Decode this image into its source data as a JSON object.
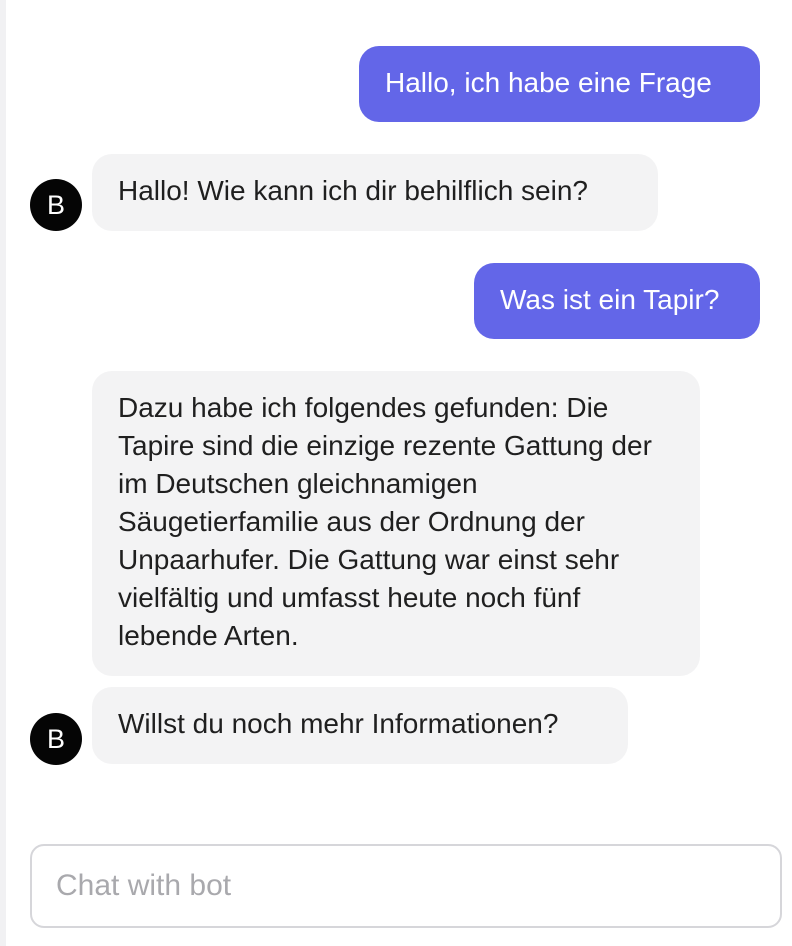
{
  "chat": {
    "header_fragment": "· · · · · · ·",
    "messages": [
      {
        "sender": "user",
        "text": "Hallo, ich habe eine Frage"
      },
      {
        "sender": "bot",
        "avatar_letter": "B",
        "text": "Hallo! Wie kann ich dir behilflich sein?"
      },
      {
        "sender": "user",
        "text": "Was ist ein Tapir?"
      },
      {
        "sender": "bot",
        "avatar_letter": "",
        "text": "Dazu habe ich folgendes gefunden: Die Tapire sind die einzige rezente Gattung der im Deutschen gleichnamigen Säugetierfamilie aus der Ordnung der Unpaarhufer. Die Gattung war einst sehr vielfältig und umfasst heute noch fünf lebende Arten."
      },
      {
        "sender": "bot",
        "avatar_letter": "B",
        "text": "Willst du noch mehr Informationen?"
      }
    ]
  },
  "composer": {
    "placeholder": "Chat with bot",
    "value": ""
  },
  "colors": {
    "user_bubble": "#6366e8",
    "bot_bubble": "#f3f3f4",
    "avatar": "#050505",
    "input_border": "#d6d6da"
  }
}
